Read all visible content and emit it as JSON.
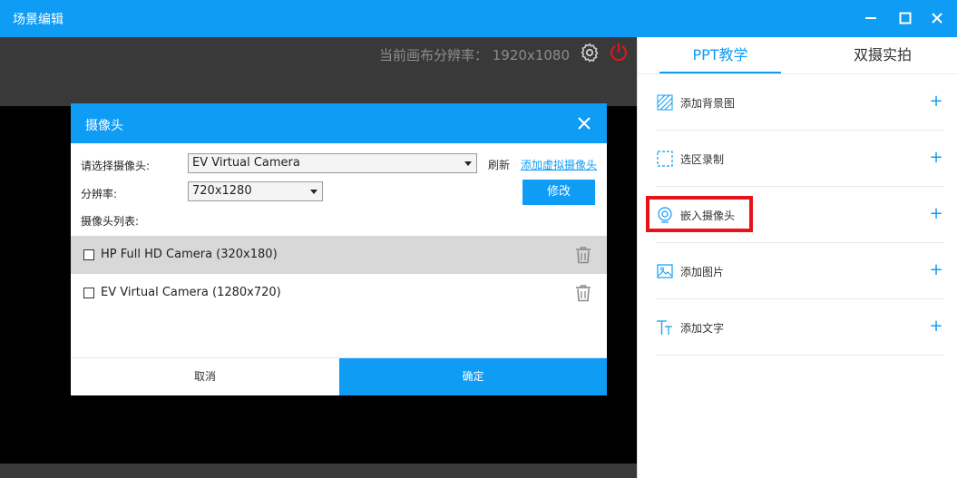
{
  "window": {
    "title": "场景编辑"
  },
  "preview": {
    "resolution_text": "当前画布分辨率：  1920x1080"
  },
  "dialog": {
    "title": "摄像头",
    "camera_label": "请选择摄像头:",
    "camera_selected": "EV Virtual Camera",
    "refresh_label": "刷新",
    "add_virtual_label": "添加虚拟摄像头",
    "resolution_label": "分辨率:",
    "resolution_selected": "720x1280",
    "modify_label": "修改",
    "list_label": "摄像头列表:",
    "cameras": [
      {
        "label": "HP Full HD Camera (320x180)",
        "selected": true
      },
      {
        "label": "EV Virtual Camera (1280x720)",
        "selected": false
      }
    ],
    "cancel_label": "取消",
    "ok_label": "确定"
  },
  "panel": {
    "tabs": [
      {
        "label": "PPT教学",
        "active": true
      },
      {
        "label": "双摄实拍",
        "active": false
      }
    ],
    "items": [
      {
        "label": "添加背景图",
        "icon": "background-icon"
      },
      {
        "label": "选区录制",
        "icon": "region-select-icon"
      },
      {
        "label": "嵌入摄像头",
        "icon": "camera-icon"
      },
      {
        "label": "添加图片",
        "icon": "image-icon"
      },
      {
        "label": "添加文字",
        "icon": "text-icon"
      }
    ],
    "plus_symbol": "+"
  },
  "colors": {
    "accent": "#0f9cf5",
    "highlight": "#e8121a",
    "power": "#e8121a"
  }
}
